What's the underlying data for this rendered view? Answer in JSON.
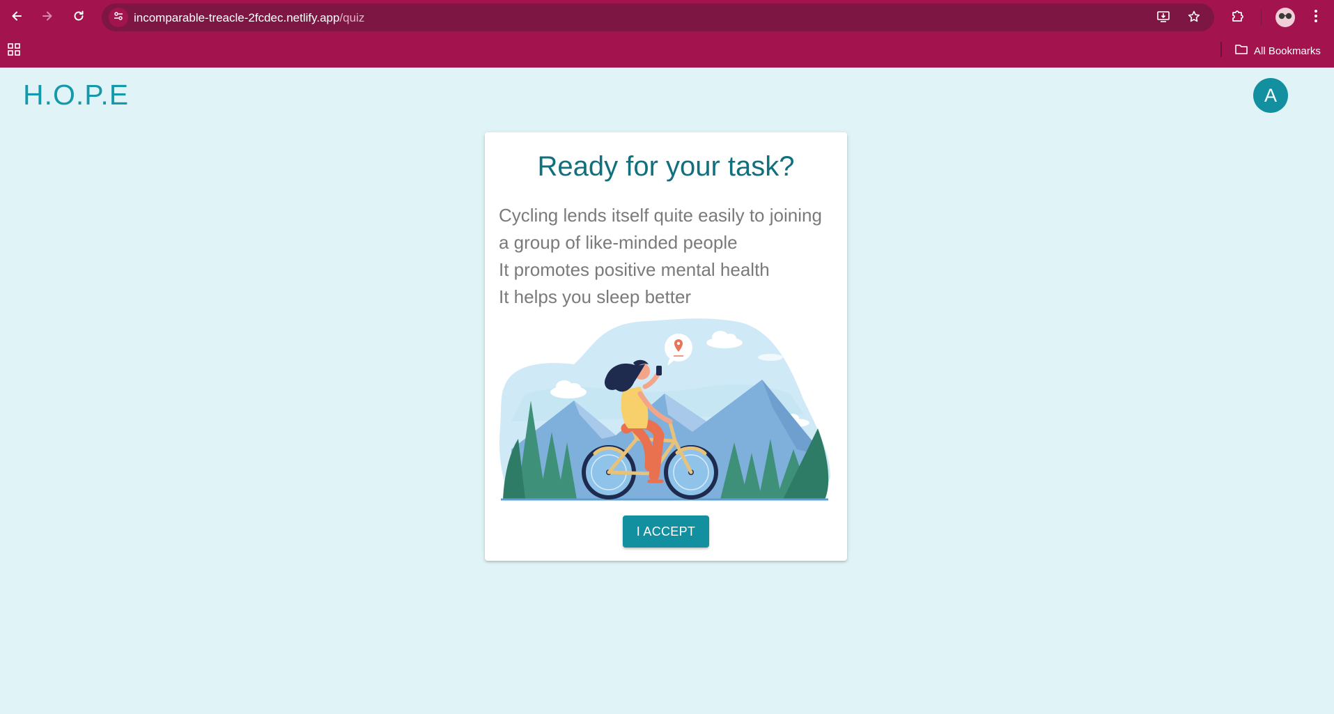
{
  "browser": {
    "url_host": "incomparable-treacle-2fcdec.netlify.app",
    "url_path": "/quiz",
    "all_bookmarks_label": "All Bookmarks"
  },
  "app": {
    "logo": "H.O.P.E",
    "user_initial": "A"
  },
  "card": {
    "title": "Ready for your task?",
    "lines": [
      "Cycling lends itself quite easily to joining",
      "a group of like-minded people",
      "It promotes positive mental health",
      "It helps you sleep better"
    ],
    "accept_label": "I ACCEPT"
  },
  "colors": {
    "chrome": "#a3144f",
    "omnibox": "#7d1643",
    "page_bg": "#e0f4f7",
    "accent": "#12909f",
    "title": "#11707e",
    "body_text": "#7a7a7a"
  }
}
